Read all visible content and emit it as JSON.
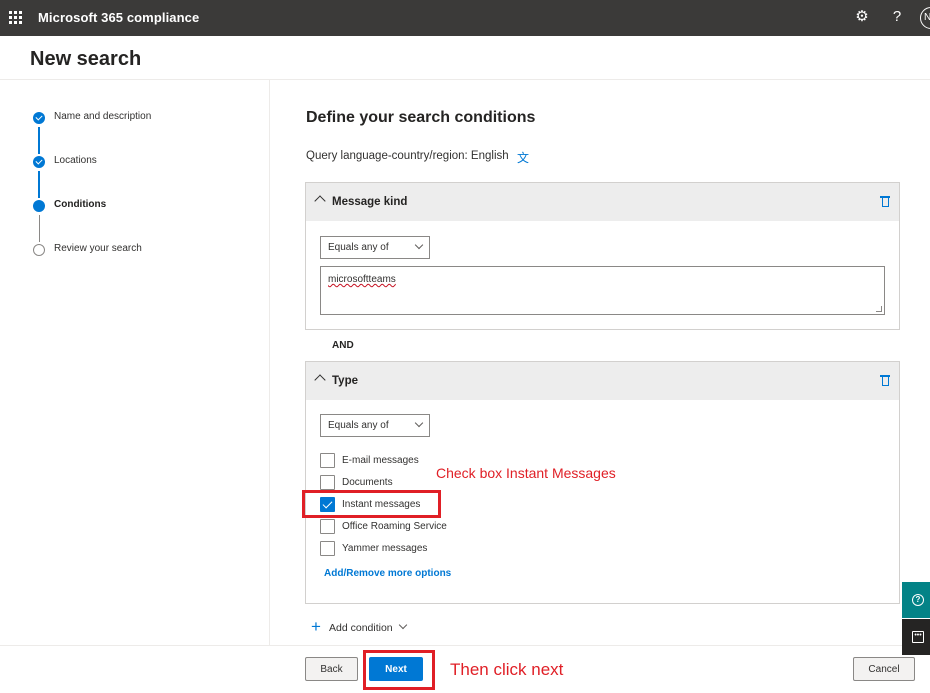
{
  "topbar": {
    "app_title": "Microsoft 365 compliance",
    "settings_icon": "gear-icon",
    "help_label": "?",
    "avatar_initial": "N"
  },
  "page": {
    "title": "New search"
  },
  "stepper": {
    "steps": [
      {
        "label": "Name and description",
        "state": "done"
      },
      {
        "label": "Locations",
        "state": "done"
      },
      {
        "label": "Conditions",
        "state": "current"
      },
      {
        "label": "Review your search",
        "state": "todo"
      }
    ]
  },
  "main": {
    "heading": "Define your search conditions",
    "query_language": "Query language-country/region: English",
    "conditions": [
      {
        "title": "Message kind",
        "operator": "Equals any of",
        "value": "microsoftteams"
      },
      {
        "title": "Type",
        "operator": "Equals any of",
        "options": [
          {
            "label": "E-mail messages",
            "checked": false
          },
          {
            "label": "Documents",
            "checked": false
          },
          {
            "label": "Instant messages",
            "checked": true
          },
          {
            "label": "Office Roaming Service",
            "checked": false
          },
          {
            "label": "Yammer messages",
            "checked": false
          }
        ],
        "more_options_link": "Add/Remove more options"
      }
    ],
    "joiner": "AND",
    "add_condition_label": "Add condition"
  },
  "footer": {
    "back_label": "Back",
    "next_label": "Next",
    "cancel_label": "Cancel"
  },
  "annotations": {
    "checkbox_hint": "Check box Instant Messages",
    "next_hint": "Then click next",
    "color": "#e01f26"
  },
  "colors": {
    "topbar": "#3b3a39",
    "accent": "#0078d4",
    "feedback_teal": "#038387"
  }
}
